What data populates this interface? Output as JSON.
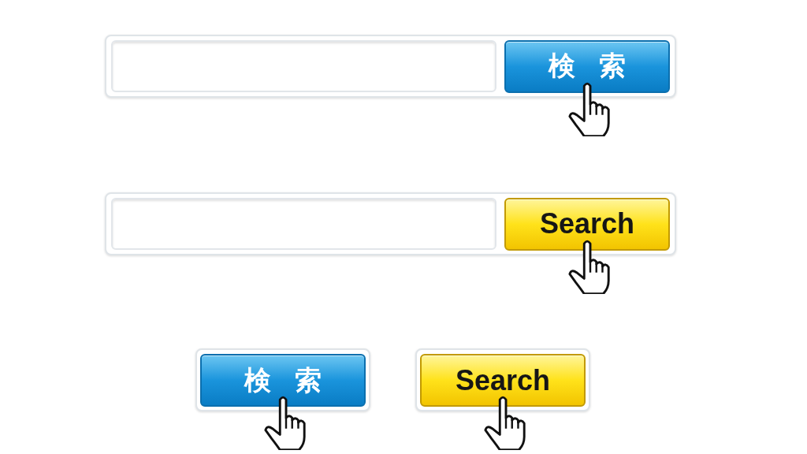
{
  "search_bars": [
    {
      "button": {
        "label": "検索",
        "kind": "blue"
      }
    },
    {
      "button": {
        "label": "Search",
        "kind": "yellow"
      }
    }
  ],
  "buttons": [
    {
      "label": "検索",
      "kind": "blue"
    },
    {
      "label": "Search",
      "kind": "yellow"
    }
  ]
}
